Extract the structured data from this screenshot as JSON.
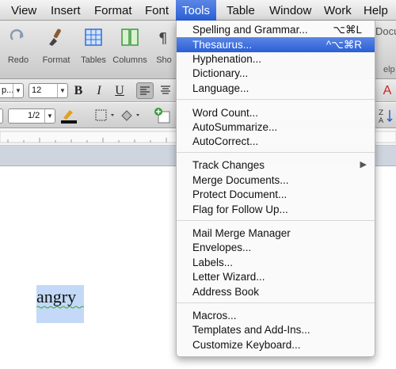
{
  "menubar": {
    "items": [
      "View",
      "Insert",
      "Format",
      "Font",
      "Tools",
      "Table",
      "Window",
      "Work",
      "Help"
    ],
    "active": "Tools"
  },
  "toolbar": {
    "redo_label": "Redo",
    "format_label": "Format",
    "tables_label": "Tables",
    "columns_label": "Columns",
    "show_label": "Sho",
    "partial_right_label": "Docu",
    "partial_right2_label": "elp"
  },
  "formatting": {
    "font_value": "p...",
    "size_value": "12",
    "spacing_value": "1/2",
    "bold": "B",
    "italic": "I",
    "underline": "U"
  },
  "document": {
    "selected_word": "angry"
  },
  "tools_menu": {
    "groups": [
      [
        {
          "label": "Spelling and Grammar...",
          "shortcut": "⌥⌘L"
        },
        {
          "label": "Thesaurus...",
          "shortcut": "^⌥⌘R",
          "highlighted": true
        },
        {
          "label": "Hyphenation..."
        },
        {
          "label": "Dictionary..."
        },
        {
          "label": "Language..."
        }
      ],
      [
        {
          "label": "Word Count..."
        },
        {
          "label": "AutoSummarize..."
        },
        {
          "label": "AutoCorrect..."
        }
      ],
      [
        {
          "label": "Track Changes",
          "submenu": true
        },
        {
          "label": "Merge Documents..."
        },
        {
          "label": "Protect Document..."
        },
        {
          "label": "Flag for Follow Up..."
        }
      ],
      [
        {
          "label": "Mail Merge Manager"
        },
        {
          "label": "Envelopes..."
        },
        {
          "label": "Labels..."
        },
        {
          "label": "Letter Wizard..."
        },
        {
          "label": "Address Book"
        }
      ],
      [
        {
          "label": "Macros..."
        },
        {
          "label": "Templates and Add-Ins..."
        },
        {
          "label": "Customize Keyboard..."
        }
      ]
    ]
  },
  "colors": {
    "menu_highlight": "#2a5fd6",
    "selection": "#c3d9f7",
    "squiggle": "#3fa33f"
  }
}
